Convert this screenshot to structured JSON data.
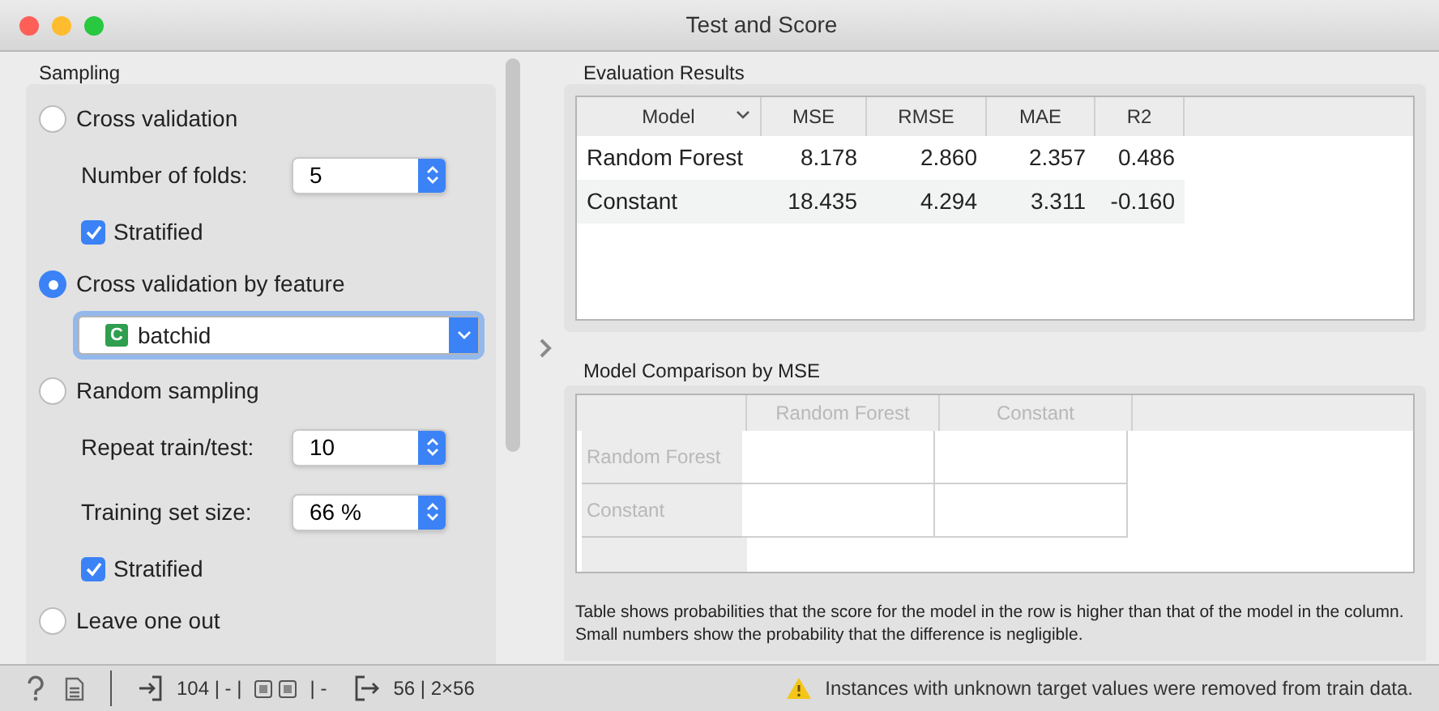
{
  "window": {
    "title": "Test and Score"
  },
  "sampling": {
    "title": "Sampling",
    "options": [
      {
        "kind": "radio",
        "label": "Cross validation",
        "selected": false
      },
      {
        "kind": "spin",
        "label": "Number of folds:",
        "value": "5"
      },
      {
        "kind": "checkbox",
        "label": "Stratified",
        "checked": true
      },
      {
        "kind": "radio",
        "label": "Cross validation by feature",
        "selected": true
      },
      {
        "kind": "combo",
        "badge": "C",
        "value": "batchid",
        "focused": true
      },
      {
        "kind": "radio",
        "label": "Random sampling",
        "selected": false
      },
      {
        "kind": "spin",
        "label": "Repeat train/test:",
        "value": "10"
      },
      {
        "kind": "spin",
        "label": "Training set size:",
        "value": "66 %"
      },
      {
        "kind": "checkbox",
        "label": "Stratified",
        "checked": true
      },
      {
        "kind": "radio",
        "label": "Leave one out",
        "selected": false
      }
    ]
  },
  "evaluation": {
    "title": "Evaluation Results",
    "columns": [
      "Model",
      "MSE",
      "RMSE",
      "MAE",
      "R2"
    ],
    "rows": [
      [
        "Random Forest",
        "8.178",
        "2.860",
        "2.357",
        "0.486"
      ],
      [
        "Constant",
        "18.435",
        "4.294",
        "3.311",
        "-0.160"
      ]
    ]
  },
  "comparison": {
    "title": "Model Comparison by MSE",
    "disabled": true,
    "columns": [
      "Random Forest",
      "Constant"
    ],
    "rows": [
      "Random Forest",
      "Constant"
    ],
    "note": "Table shows probabilities that the score for the model in the row is higher than that of the model in the column. Small numbers show the probability that the difference is negligible."
  },
  "status_bar": {
    "input": "104 | - |",
    "input_tail": "| -",
    "output": "56 | 2×56",
    "warning": "Instances with unknown target values were removed from train data."
  }
}
